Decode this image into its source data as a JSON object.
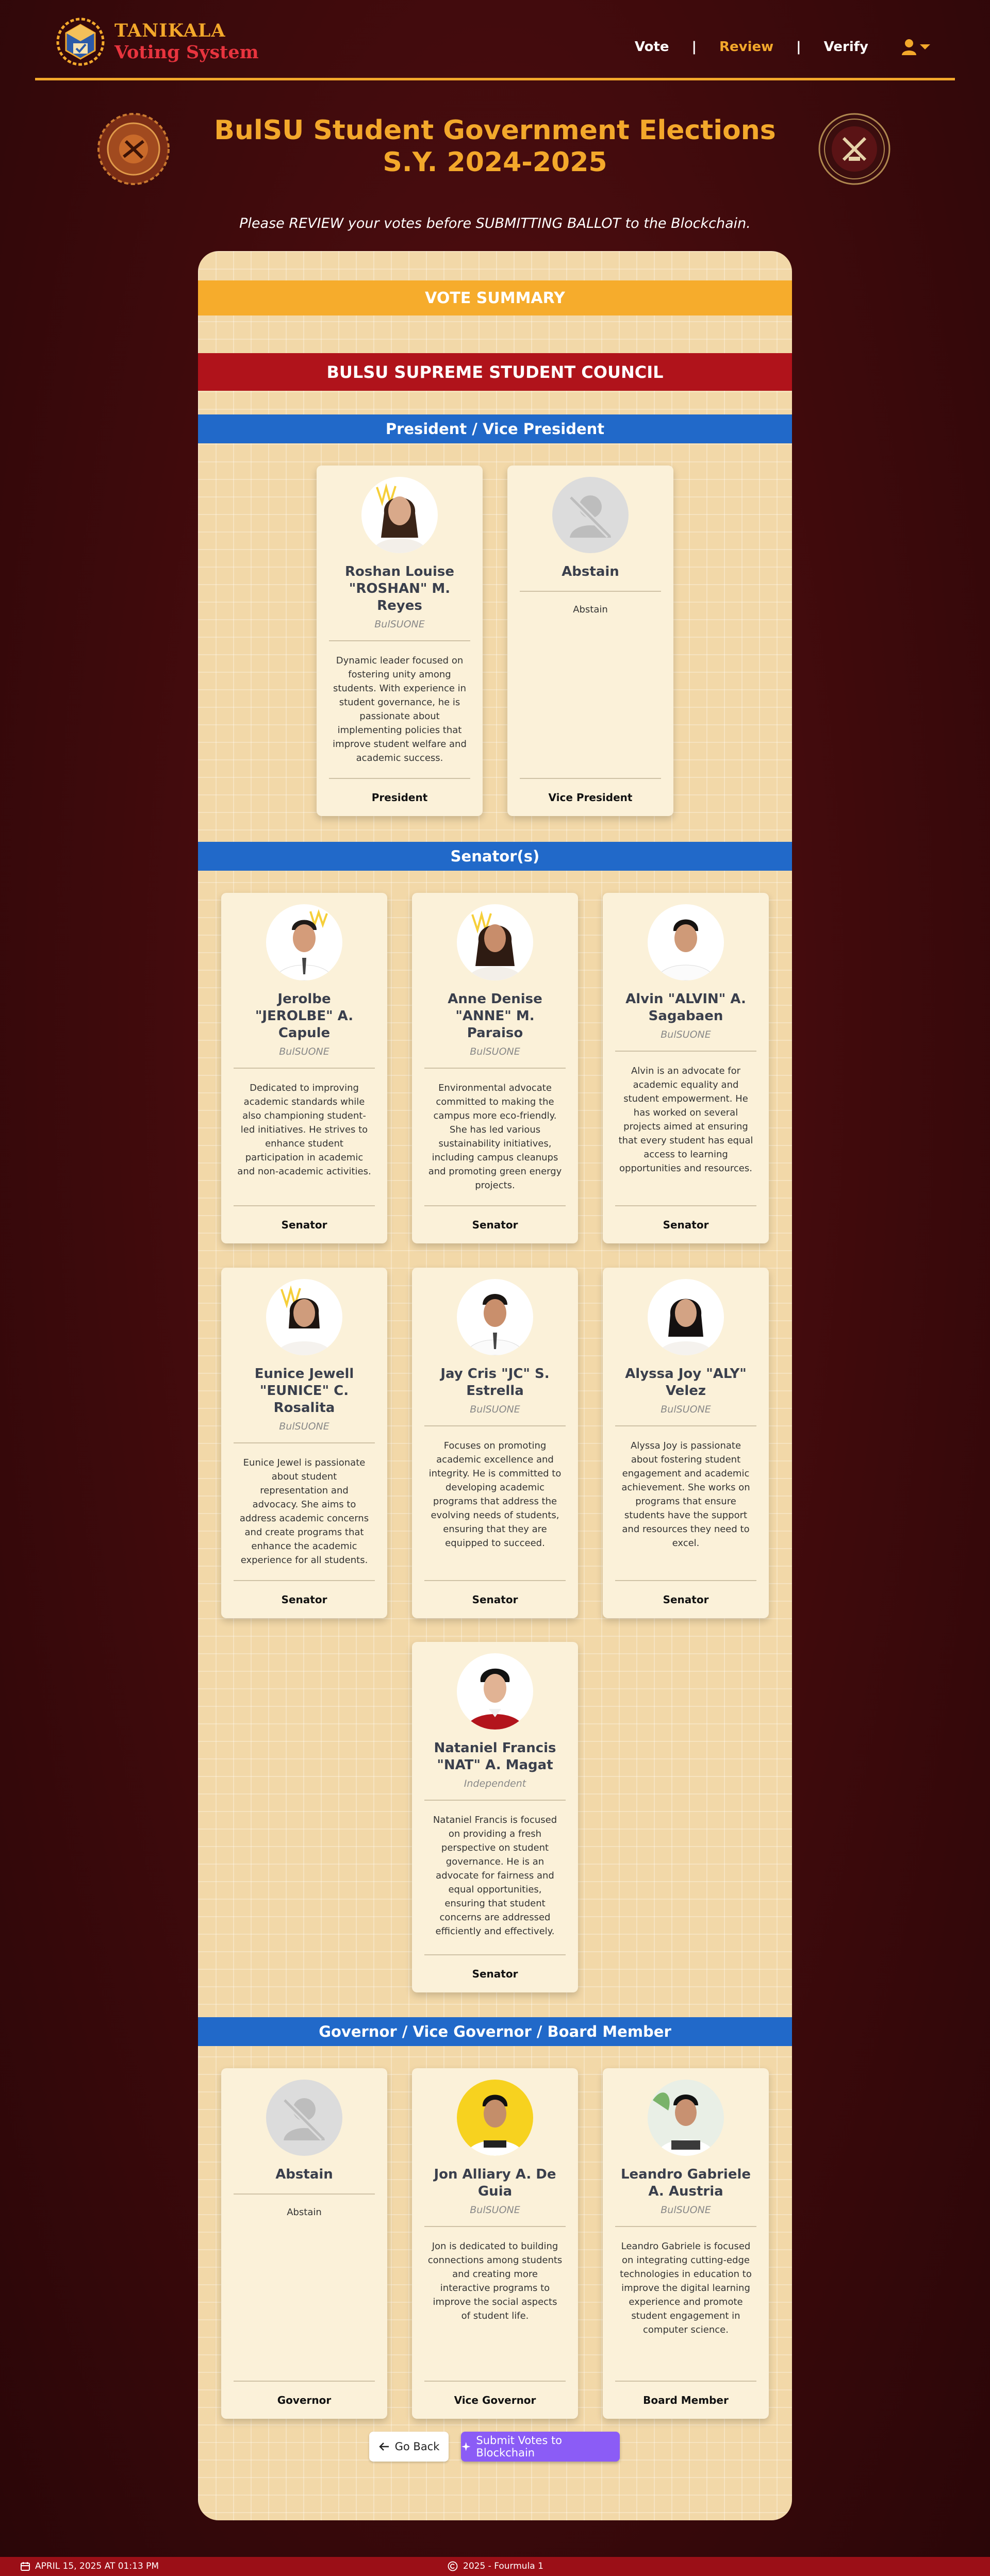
{
  "header": {
    "brand_line1": "TANIKALA",
    "brand_line2": "Voting System",
    "nav": [
      {
        "label": "Vote"
      },
      {
        "label": "Review"
      },
      {
        "label": "Verify"
      }
    ],
    "separator": "|",
    "active_nav": "Review"
  },
  "title": "BulSU Student Government Elections S.Y. 2024-2025",
  "instructions": "Please REVIEW your votes before SUBMITTING BALLOT to the Blockchain.",
  "summary": {
    "heading": "VOTE SUMMARY",
    "council": "BULSU SUPREME STUDENT COUNCIL",
    "sections": [
      {
        "title": "President / Vice President",
        "candidates": [
          {
            "name": "Roshan Louise \"ROSHAN\" M. Reyes",
            "party": "BulSUONE",
            "desc": "Dynamic leader focused on fostering unity among students. With experience in student governance, he is passionate about implementing policies that improve student welfare and academic success.",
            "position": "President"
          },
          {
            "name": "Abstain",
            "party": "",
            "desc": "Abstain",
            "position": "Vice President"
          }
        ]
      },
      {
        "title": "Senator(s)",
        "candidates": [
          {
            "name": "Jerolbe \"JEROLBE\" A. Capule",
            "party": "BulSUONE",
            "desc": "Dedicated to improving academic standards while also championing student-led initiatives. He strives to enhance student participation in academic and non-academic activities.",
            "position": "Senator"
          },
          {
            "name": "Anne Denise \"ANNE\" M. Paraiso",
            "party": "BulSUONE",
            "desc": "Environmental advocate committed to making the campus more eco-friendly. She has led various sustainability initiatives, including campus cleanups and promoting green energy projects.",
            "position": "Senator"
          },
          {
            "name": "Alvin \"ALVIN\" A. Sagabaen",
            "party": "BulSUONE",
            "desc": "Alvin is an advocate for academic equality and student empowerment. He has worked on several projects aimed at ensuring that every student has equal access to learning opportunities and resources.",
            "position": "Senator"
          },
          {
            "name": "Eunice Jewell \"EUNICE\" C. Rosalita",
            "party": "BulSUONE",
            "desc": "Eunice Jewel is passionate about student representation and advocacy. She aims to address academic concerns and create programs that enhance the academic experience for all students.",
            "position": "Senator"
          },
          {
            "name": "Jay Cris \"JC\" S. Estrella",
            "party": "BulSUONE",
            "desc": "Focuses on promoting academic excellence and integrity. He is committed to developing academic programs that address the evolving needs of students, ensuring that they are equipped to succeed.",
            "position": "Senator"
          },
          {
            "name": "Alyssa Joy \"ALY\" Velez",
            "party": "BulSUONE",
            "desc": "Alyssa Joy is passionate about fostering student engagement and academic achievement. She works on programs that ensure students have the support and resources they need to excel.",
            "position": "Senator"
          },
          {
            "name": "Nataniel Francis \"NAT\" A. Magat",
            "party": "Independent",
            "desc": "Nataniel Francis is focused on providing a fresh perspective on student governance. He is an advocate for fairness and equal opportunities, ensuring that student concerns are addressed efficiently and effectively.",
            "position": "Senator"
          }
        ]
      },
      {
        "title": "Governor / Vice Governor / Board Member",
        "candidates": [
          {
            "name": "Abstain",
            "party": "",
            "desc": "Abstain",
            "position": "Governor"
          },
          {
            "name": "Jon Alliary A. De Guia",
            "party": "BulSUONE",
            "desc": "Jon is dedicated to building connections among students and creating more interactive programs to improve the social aspects of student life.",
            "position": "Vice Governor"
          },
          {
            "name": "Leandro Gabriele A. Austria",
            "party": "BulSUONE",
            "desc": "Leandro Gabriele is focused on integrating cutting-edge technologies in education to improve the digital learning experience and promote student engagement in computer science.",
            "position": "Board Member"
          }
        ]
      }
    ]
  },
  "buttons": {
    "back": "Go Back",
    "submit": "Submit Votes to Blockchain"
  },
  "footer": {
    "datetime": "APRIL 15, 2025 AT 01:13 PM",
    "copyright": "2025 - Fourmula 1"
  },
  "colors": {
    "accent": "#f3a82b",
    "council_band": "#b0131b",
    "section_band": "#2169c9",
    "submit": "#8b5cf6",
    "footer": "#9b0f17"
  },
  "icons": [
    "chain-logo",
    "user-icon",
    "caret-down-icon",
    "seal-left",
    "seal-right",
    "abstain-icon",
    "arrow-left-icon",
    "sparkle-icon",
    "calendar-icon",
    "copyright-icon"
  ]
}
